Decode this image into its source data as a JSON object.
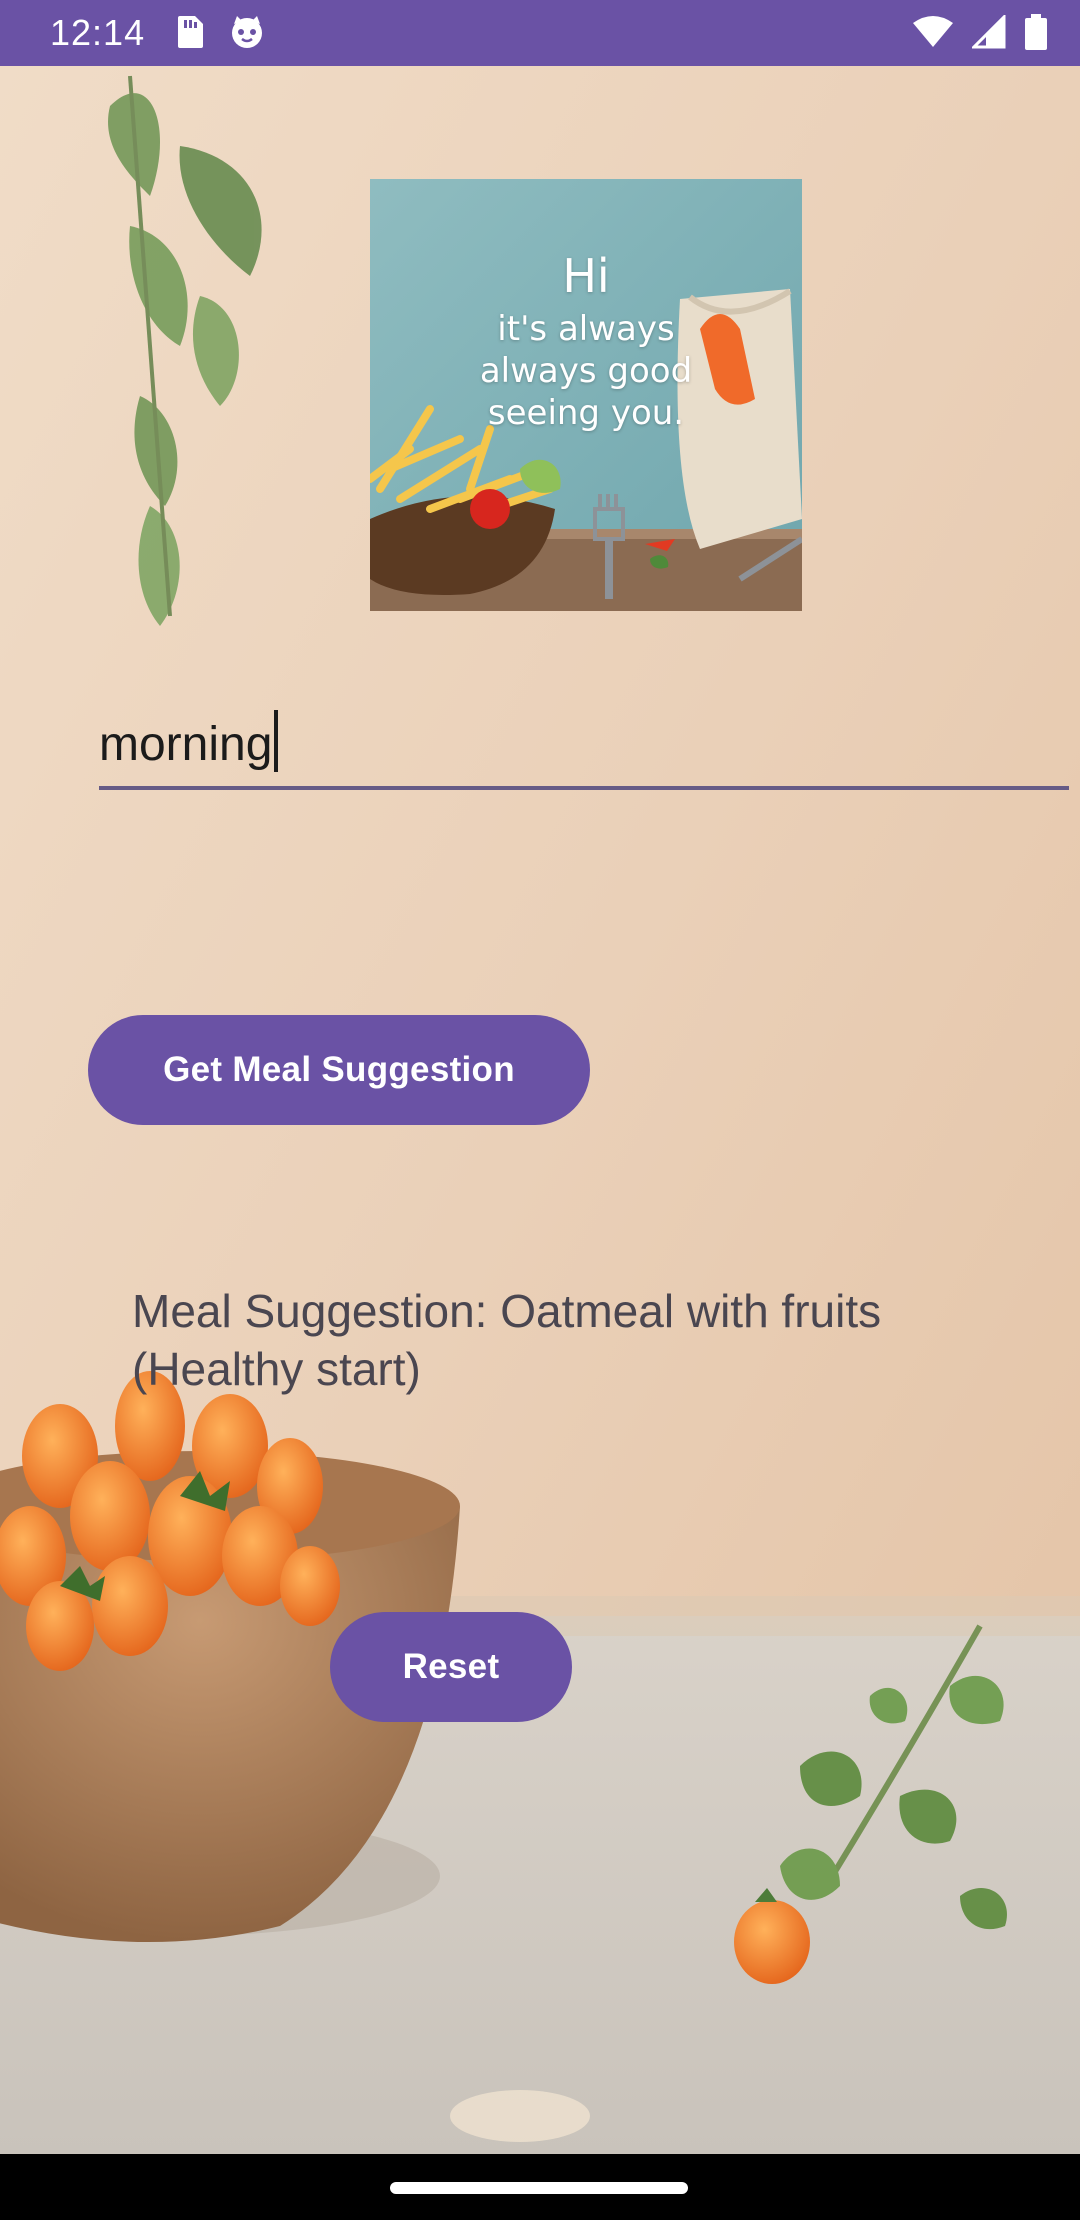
{
  "status_bar": {
    "time": "12:14",
    "left_icons": [
      "sim-card-icon",
      "cat-face-icon"
    ],
    "right_icons": [
      "wifi-icon",
      "cell-signal-icon",
      "battery-icon"
    ],
    "color": "#6a52a5"
  },
  "hero": {
    "line_hi": "Hi",
    "line_1": "it's always",
    "line_2": "always good",
    "line_3": "seeing you."
  },
  "input": {
    "value": "morning"
  },
  "buttons": {
    "suggest_label": "Get Meal Suggestion",
    "reset_label": "Reset",
    "color": "#6a52a5"
  },
  "result": {
    "text": "Meal Suggestion: Oatmeal with fruits (Healthy start)"
  }
}
